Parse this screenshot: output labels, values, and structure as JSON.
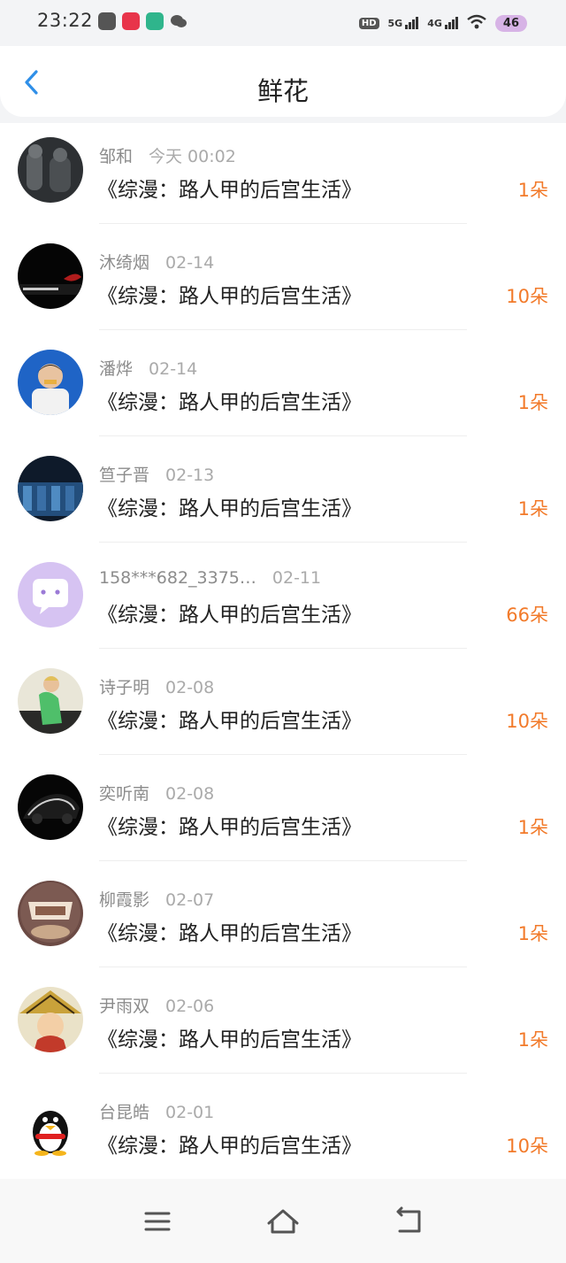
{
  "status_bar": {
    "time": "23:22",
    "hd": "HD",
    "net1": "5G",
    "net2": "4G",
    "battery": "46"
  },
  "header": {
    "title": "鲜花",
    "back_icon": "chevron-left-icon"
  },
  "items": [
    {
      "name": "邹和",
      "time": "今天 00:02",
      "book": "《综漫：路人甲的后宫生活》",
      "count": "1朵"
    },
    {
      "name": "沐绮烟",
      "time": "02-14",
      "book": "《综漫：路人甲的后宫生活》",
      "count": "10朵"
    },
    {
      "name": "潘烨",
      "time": "02-14",
      "book": "《综漫：路人甲的后宫生活》",
      "count": "1朵"
    },
    {
      "name": "笪子晋",
      "time": "02-13",
      "book": "《综漫：路人甲的后宫生活》",
      "count": "1朵"
    },
    {
      "name": "158***682_3375…",
      "time": "02-11",
      "book": "《综漫：路人甲的后宫生活》",
      "count": "66朵"
    },
    {
      "name": "诗子明",
      "time": "02-08",
      "book": "《综漫：路人甲的后宫生活》",
      "count": "10朵"
    },
    {
      "name": "奕听南",
      "time": "02-08",
      "book": "《综漫：路人甲的后宫生活》",
      "count": "1朵"
    },
    {
      "name": "柳霞影",
      "time": "02-07",
      "book": "《综漫：路人甲的后宫生活》",
      "count": "1朵"
    },
    {
      "name": "尹雨双",
      "time": "02-06",
      "book": "《综漫：路人甲的后宫生活》",
      "count": "1朵"
    },
    {
      "name": "台昆皓",
      "time": "02-01",
      "book": "《综漫：路人甲的后宫生活》",
      "count": "10朵"
    }
  ],
  "nav_bar": {
    "menu_icon": "menu-icon",
    "home_icon": "home-icon",
    "back_icon": "back-icon"
  },
  "colors": {
    "accent": "#2f8fe8",
    "count": "#f27a2a"
  }
}
